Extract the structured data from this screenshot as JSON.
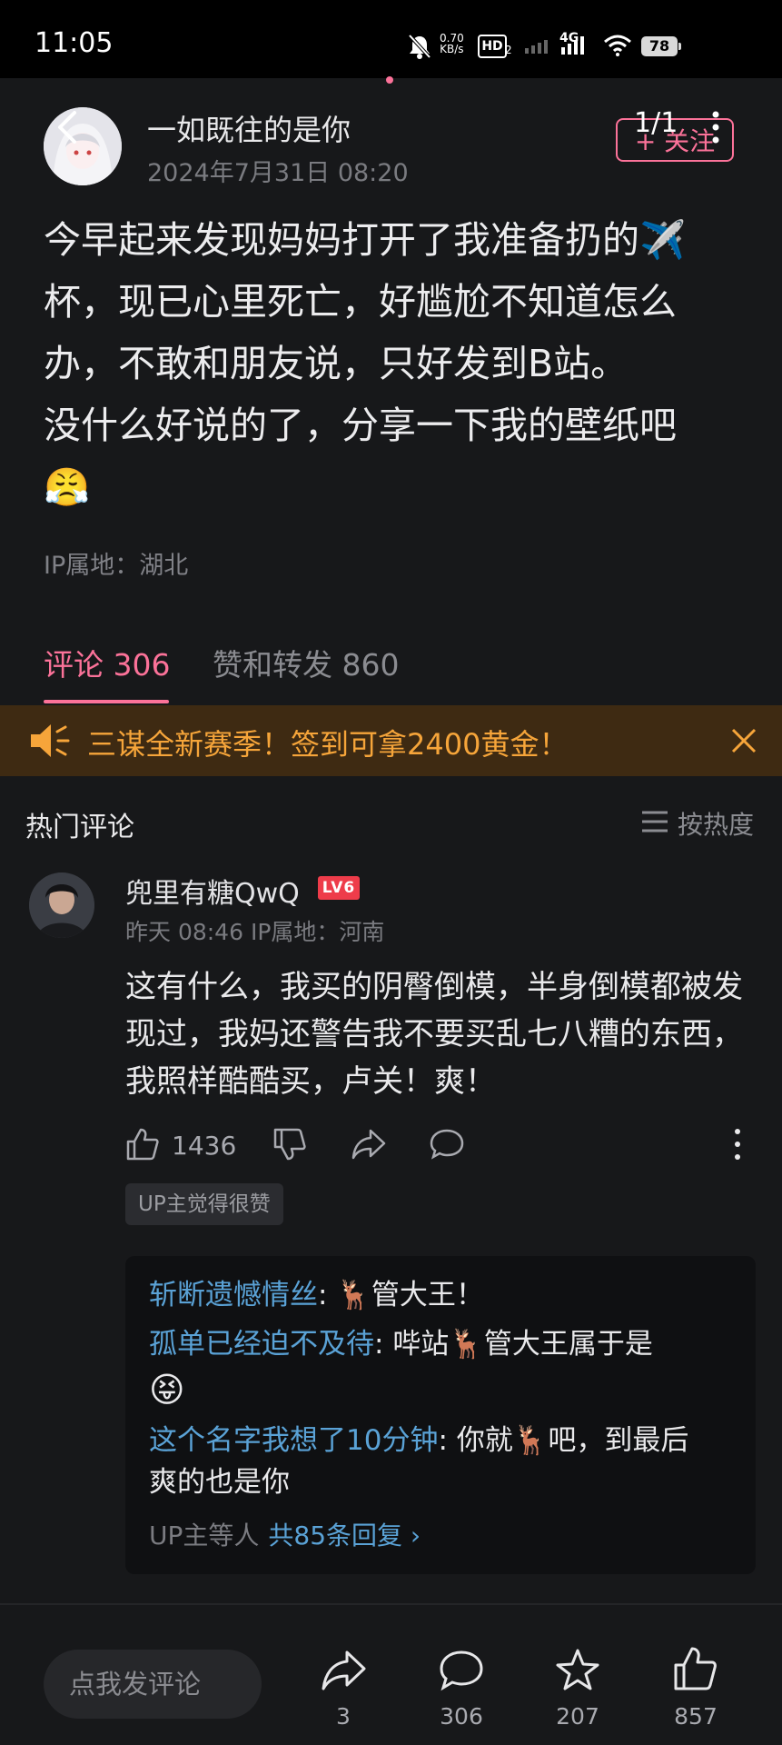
{
  "status_bar": {
    "time": "11:05",
    "net_speed": "0.70",
    "net_unit": "KB/s",
    "hd": "HD",
    "hd_sub": "2",
    "network": "4G",
    "battery": "78"
  },
  "post": {
    "author": "一如既往的是你",
    "date": "2024年7月31日 08:20",
    "follow_label": "+ 关注",
    "page_indicator": "1/1",
    "text": "今早起来发现妈妈打开了我准备扔的✈️杯，现已心里死亡，好尴尬不知道怎么办，不敢和朋友说，只好发到B站。\n没什么好说的了，分享一下我的壁纸吧\n😤",
    "ip": "IP属地：湖北"
  },
  "tabs": [
    {
      "label": "评论 306"
    },
    {
      "label": "赞和转发 860"
    }
  ],
  "banner": {
    "text": "三谋全新赛季！签到可拿2400黄金！"
  },
  "comments_header": {
    "title": "热门评论",
    "sort_label": "按热度"
  },
  "comment": {
    "user": "兜里有糖QwQ",
    "level": "LV6",
    "meta": "昨天 08:46  IP属地：河南",
    "text": "这有什么，我买的阴臀倒模，半身倒模都被发现过，我妈还警告我不要买乱七八糟的东西，我照样酷酷买，卢关！爽！",
    "likes": "1436",
    "badge": "UP主觉得很赞",
    "replies": [
      {
        "name": "斩断遗憾情丝",
        "text": ": 🦌管大王！"
      },
      {
        "name": "孤单已经迫不及待",
        "text": ": 哔站🦌管大王属于是"
      },
      {
        "name": "",
        "text": "😝"
      },
      {
        "name": "这个名字我想了10分钟",
        "text": ": 你就🦌吧，到最后"
      },
      {
        "name": "",
        "text": "爽的也是你"
      }
    ],
    "reply_footer_prefix": "UP主等人",
    "reply_footer_link": "共85条回复 ›"
  },
  "bottom_bar": {
    "placeholder": "点我发评论",
    "share_count": "3",
    "comment_count": "306",
    "favorite_count": "207",
    "like_count": "857"
  }
}
